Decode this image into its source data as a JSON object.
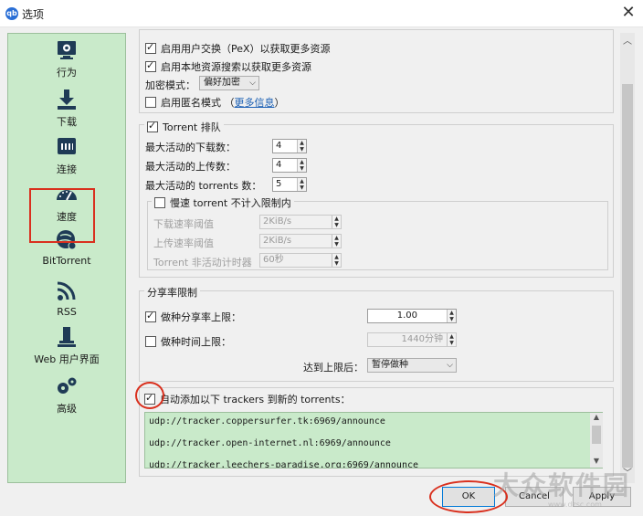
{
  "window": {
    "title": "选项",
    "icon_text": "qb",
    "close_glyph": "✕"
  },
  "sidebar": {
    "items": [
      {
        "label": "行为",
        "icon": "behavior-icon"
      },
      {
        "label": "下载",
        "icon": "download-icon"
      },
      {
        "label": "连接",
        "icon": "connection-icon"
      },
      {
        "label": "速度",
        "icon": "speed-icon"
      },
      {
        "label": "BitTorrent",
        "icon": "bittorrent-icon",
        "selected": true
      },
      {
        "label": "RSS",
        "icon": "rss-icon"
      },
      {
        "label": "Web 用户界面",
        "icon": "web-ui-icon"
      },
      {
        "label": "高级",
        "icon": "advanced-icon"
      }
    ]
  },
  "privacy": {
    "pex_label": "启用用户交换（PeX）以获取更多资源",
    "pex_checked": true,
    "lsd_label": "启用本地资源搜索以获取更多资源",
    "lsd_checked": true,
    "encryption_label": "加密模式：",
    "encryption_value": "偏好加密",
    "anon_label": "启用匿名模式",
    "anon_checked": false,
    "more_info_open": "（",
    "more_info_link": "更多信息",
    "more_info_close": "）"
  },
  "queue": {
    "group_label": "Torrent 排队",
    "group_checked": true,
    "max_downloads_label": "最大活动的下载数：",
    "max_downloads_value": "4",
    "max_uploads_label": "最大活动的上传数：",
    "max_uploads_value": "4",
    "max_torrents_label": "最大活动的 torrents 数：",
    "max_torrents_value": "5",
    "slow_label": "慢速 torrent 不计入限制内",
    "slow_checked": false,
    "dl_rate_label": "下载速率阈值",
    "dl_rate_value": "2KiB/s",
    "ul_rate_label": "上传速率阈值",
    "ul_rate_value": "2KiB/s",
    "inactive_label": "Torrent 非活动计时器",
    "inactive_value": "60秒"
  },
  "share": {
    "group_label": "分享率限制",
    "ratio_label": "做种分享率上限：",
    "ratio_checked": true,
    "ratio_value": "1.00",
    "time_label": "做种时间上限：",
    "time_checked": false,
    "time_value": "1440分钟",
    "action_label": "达到上限后：",
    "action_value": "暂停做种"
  },
  "trackers": {
    "auto_label": "自动添加以下 trackers 到新的 torrents：",
    "auto_checked": true,
    "list": [
      "udp://tracker.coppersurfer.tk:6969/announce",
      "udp://tracker.open-internet.nl:6969/announce",
      "udp://tracker.leechers-paradise.org:6969/announce"
    ]
  },
  "buttons": {
    "ok": "OK",
    "cancel": "Cancel",
    "apply": "Apply"
  },
  "watermark": {
    "text": "大众软件园",
    "sub": "www.dzsc.com"
  },
  "colors": {
    "sidebar_bg": "#c9eaca",
    "highlight_red": "#d9301e",
    "link": "#1a5fb4"
  }
}
